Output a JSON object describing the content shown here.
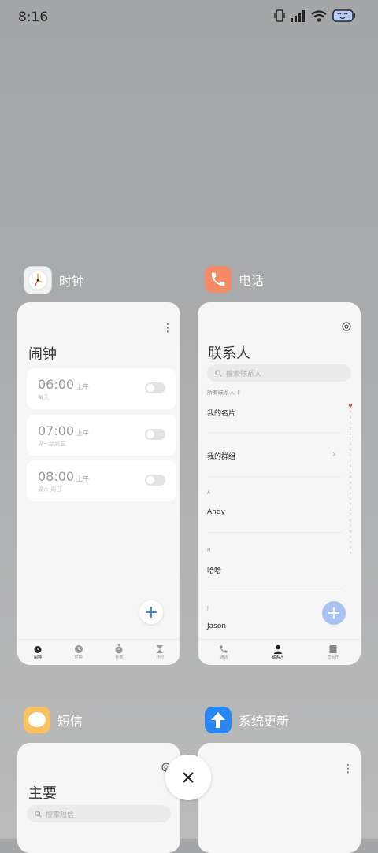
{
  "status": {
    "time": "8:16"
  },
  "apps": {
    "clock": {
      "name": "时钟",
      "title": "闹钟",
      "alarms": [
        {
          "time": "06:00",
          "ampm": "上午",
          "sub": "每天"
        },
        {
          "time": "07:00",
          "ampm": "上午",
          "sub": "周一至周五"
        },
        {
          "time": "08:00",
          "ampm": "上午",
          "sub": "周六 周日"
        }
      ],
      "nav": [
        "闹钟",
        "时钟",
        "秒表",
        "计时"
      ]
    },
    "phone": {
      "name": "电话",
      "title": "联系人",
      "search_placeholder": "搜索联系人",
      "filter": "所有联系人 ⇕",
      "my_card": "我的名片",
      "my_groups": "我的群组",
      "sections": [
        {
          "letter": "A",
          "name": "Andy"
        },
        {
          "letter": "H",
          "name": "哈哈"
        },
        {
          "letter": "J",
          "name": "Jason"
        }
      ],
      "alphabet": [
        "♥",
        "A",
        "B",
        "C",
        "D",
        "E",
        "F",
        "G",
        "H",
        "I",
        "J",
        "K",
        "L",
        "M",
        "N",
        "O",
        "P",
        "Q",
        "R",
        "S",
        "T",
        "U",
        "V",
        "W",
        "X",
        "Y",
        "Z",
        "#"
      ],
      "nav": [
        "通话",
        "联系人",
        "营业厅"
      ]
    },
    "sms": {
      "name": "短信",
      "title": "主要",
      "search_placeholder": "搜索短信"
    },
    "update": {
      "name": "系统更新"
    }
  },
  "colors": {
    "accent": "#3b7cf0",
    "phone_icon": "#f48a66",
    "sms_icon": "#f8c25e",
    "update_icon": "#2a86f2"
  }
}
